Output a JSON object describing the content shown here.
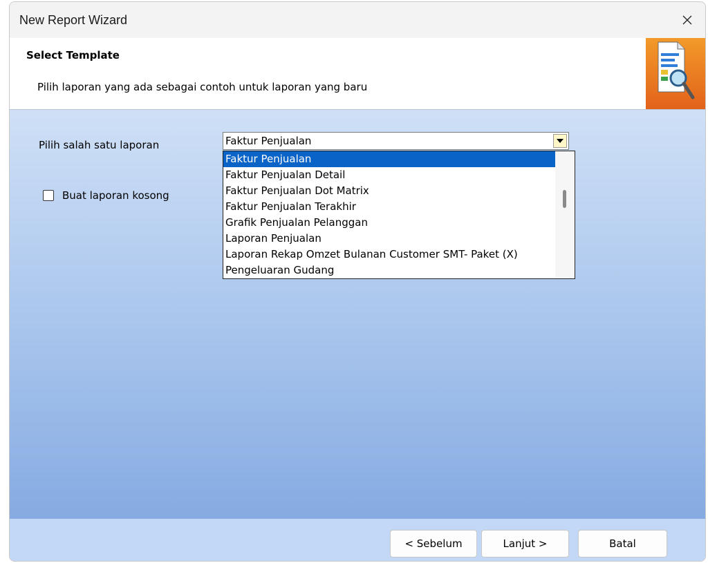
{
  "window": {
    "title": "New Report Wizard"
  },
  "header": {
    "title": "Select Template",
    "description": "Pilih laporan yang ada sebagai contoh untuk laporan yang baru"
  },
  "form": {
    "pilih_label": "Pilih salah satu laporan",
    "selected_value": "Faktur Penjualan",
    "options": [
      "Faktur Penjualan",
      "Faktur Penjualan Detail",
      "Faktur Penjualan Dot Matrix",
      "Faktur Penjualan Terakhir",
      "Grafik Penjualan Pelanggan",
      "Laporan Penjualan",
      "Laporan Rekap Omzet Bulanan Customer SMT- Paket (X)",
      "Pengeluaran Gudang"
    ],
    "selected_index": 0,
    "checkbox_label": "Buat laporan kosong",
    "checkbox_checked": false
  },
  "buttons": {
    "back": "< Sebelum",
    "next": "Lanjut >",
    "cancel": "Batal"
  },
  "icons": {
    "close": "close-icon",
    "header": "report-magnifier-icon",
    "dropdown": "dropdown-arrow-icon"
  },
  "colors": {
    "selection": "#0a64c8",
    "header_icon_bg": "#e2621a",
    "combo_button": "#fff7c8"
  }
}
